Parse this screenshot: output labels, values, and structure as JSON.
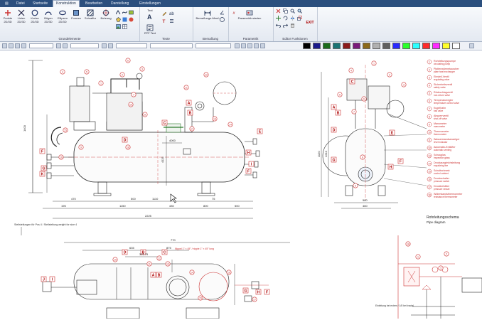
{
  "ribbon": {
    "tabs": [
      "Datei",
      "Startseite",
      "Konstruktion",
      "Bearbeiten",
      "Darstellung",
      "Einstellungen"
    ],
    "active_tab": "Konstruktion",
    "groups": {
      "grundelemente": {
        "label": "Grundelemente",
        "buttons": [
          {
            "label": "Punkte",
            "sub": "2D/3D"
          },
          {
            "label": "Linien",
            "sub": "2D/3D"
          },
          {
            "label": "Kreise",
            "sub": "2D/3D"
          },
          {
            "label": "Bögen",
            "sub": "2D/3D"
          },
          {
            "label": "Ellipsen",
            "sub": "2D/3D"
          }
        ],
        "more": [
          "Formen",
          "Schraffur",
          "Bohrung"
        ]
      },
      "texte": {
        "label": "Texte",
        "buttons": [
          {
            "label": "Text"
          },
          {
            "label": "RTF Text"
          }
        ]
      },
      "bemassung": {
        "label": "Bemaßung",
        "buttons": [
          {
            "label": "Bemaßungs-Menü"
          }
        ]
      },
      "parametrik": {
        "label": "Parametrik",
        "buttons": [
          {
            "label": "Parametrik starten"
          }
        ]
      },
      "editor": {
        "label": "Editor Funktionen",
        "exit_label": "EXIT"
      }
    }
  },
  "toolbar": {
    "colors": [
      "#000000",
      "#1a1a8c",
      "#1a6b1a",
      "#1a7373",
      "#8c1a1a",
      "#7a1a7a",
      "#8c6a1a",
      "#b0b0b0",
      "#5f5f5f",
      "#2a2aff",
      "#2aff2a",
      "#2affff",
      "#ff2a2a",
      "#ff2aff",
      "#ffff2a",
      "#ffffff"
    ]
  },
  "drawing": {
    "dimensions_front": {
      "overall": "2225",
      "row1": [
        "470",
        "500",
        "1110",
        "75"
      ],
      "row2": [
        "195",
        "1150",
        "430",
        "800",
        "500"
      ],
      "height_left": "1400",
      "height_mid": "4115",
      "pipe_span": "4000",
      "note": "Stellstellungen für Pos 4 / Stellstellung weight for size 4"
    },
    "dimensions_side": {
      "heights": [
        "1120",
        "1210"
      ],
      "widths": [
        "580",
        "460"
      ]
    },
    "labels_front": [
      "A",
      "B",
      "C",
      "D",
      "E",
      "F",
      "G",
      "H",
      "I",
      "J",
      "K"
    ],
    "balloon_numbers": [
      "1",
      "2",
      "3",
      "4",
      "5",
      "6",
      "7",
      "8",
      "9",
      "10",
      "11",
      "12",
      "13",
      "14",
      "15",
      "16",
      "17",
      "18"
    ],
    "legend": [
      {
        "n": "1",
        "de": "Rohrleitungspumpe",
        "en": "circulating pump"
      },
      {
        "n": "2",
        "de": "Plattenwärmetauscher",
        "en": "plate heat exchanger"
      },
      {
        "n": "3",
        "de": "Einstell-Ventil",
        "en": "regulating valve"
      },
      {
        "n": "4",
        "de": "Sicherheitsventil",
        "en": "safety valve"
      },
      {
        "n": "5",
        "de": "Rückschlagventil",
        "en": "non-return valve"
      },
      {
        "n": "6",
        "de": "Temperaturregler",
        "en": "temperature control valve"
      },
      {
        "n": "7",
        "de": "Kugelhahn",
        "en": "ball valve"
      },
      {
        "n": "8",
        "de": "Absperrventil",
        "en": "shut-off valve"
      },
      {
        "n": "9",
        "de": "Manometer",
        "en": "manometer"
      },
      {
        "n": "10",
        "de": "Thermometer",
        "en": "thermometer"
      },
      {
        "n": "11",
        "de": "Wasserstandsanzeiger",
        "en": "level indicator"
      },
      {
        "n": "12",
        "de": "Automatik-Entlüfter",
        "en": "automatic venting"
      },
      {
        "n": "13",
        "de": "Schauglas",
        "en": "inspection glass"
      },
      {
        "n": "14",
        "de": "Druckausgleichsleitung",
        "en": "equalizing line"
      },
      {
        "n": "15",
        "de": "Schaltschrank",
        "en": "control cabinet"
      },
      {
        "n": "16",
        "de": "Druckschalter",
        "en": "pressure switch"
      },
      {
        "n": "17",
        "de": "Druckbehälter",
        "en": "pressure vessel"
      },
      {
        "n": "18",
        "de": "Widerstandsthermometer",
        "en": "resistance thermometer"
      }
    ],
    "schema_title": "Rohrleitungsschema",
    "schema_subtitle": "Pipe diagram",
    "plan_dims": [
      "770",
      "635",
      "875",
      "301.75"
    ],
    "plan_note": "Nippel 1\" × 45° / nipple 1\" × 45° long",
    "schema_note": "Einleitung bei extern / 1/8 bei tractal"
  }
}
